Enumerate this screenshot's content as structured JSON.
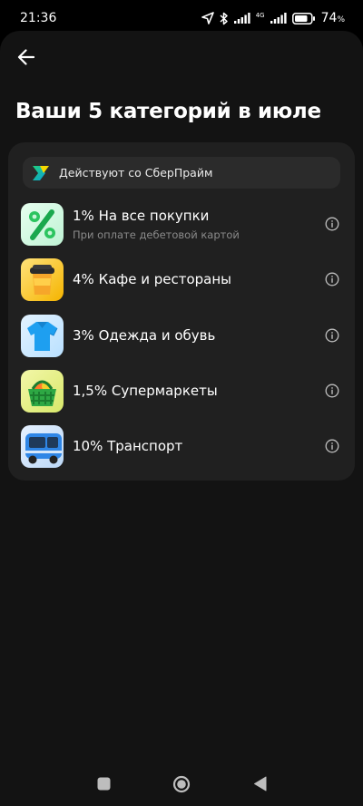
{
  "status_bar": {
    "time": "21:36",
    "network": "4G",
    "battery": "74",
    "icons": [
      "location-icon",
      "bluetooth-icon",
      "signal-icon",
      "network-4g-icon",
      "signal-icon",
      "battery-icon"
    ]
  },
  "header": {
    "back_icon": "arrow-left-icon",
    "title": "Ваши 5 категорий в июле"
  },
  "prime_banner": {
    "label": "Действуют со СберПрайм",
    "icon": "sberprime-logo-icon"
  },
  "categories": [
    {
      "title": "1% На все покупки",
      "subtitle": "При оплате дебетовой картой",
      "icon": "percent-icon"
    },
    {
      "title": "4% Кафе и рестораны",
      "subtitle": "",
      "icon": "coffee-cup-icon"
    },
    {
      "title": "3% Одежда и обувь",
      "subtitle": "",
      "icon": "polo-shirt-icon"
    },
    {
      "title": "1,5% Супермаркеты",
      "subtitle": "",
      "icon": "shopping-basket-icon"
    },
    {
      "title": "10% Транспорт",
      "subtitle": "",
      "icon": "bus-icon"
    }
  ],
  "nav_bar": {
    "icons": [
      "recent-apps-icon",
      "home-icon",
      "back-triangle-icon"
    ]
  },
  "colors": {
    "screen_bg": "#131313",
    "card_bg": "#202020",
    "banner_bg": "#2b2b2b",
    "subtitle": "#8a8a8a"
  }
}
